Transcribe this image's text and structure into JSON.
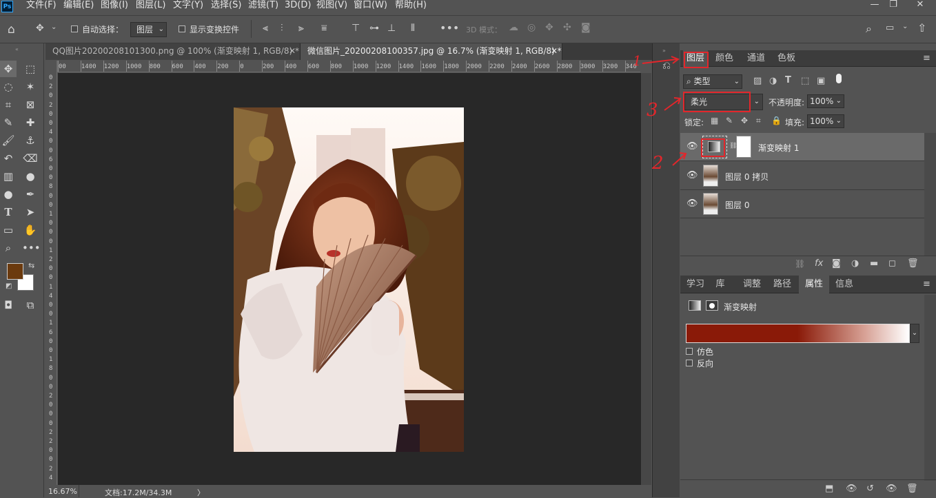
{
  "app": {
    "logo": "Ps"
  },
  "menu": [
    "文件(F)",
    "编辑(E)",
    "图像(I)",
    "图层(L)",
    "文字(Y)",
    "选择(S)",
    "滤镜(T)",
    "3D(D)",
    "视图(V)",
    "窗口(W)",
    "帮助(H)"
  ],
  "window_buttons": [
    "—",
    "❐",
    "✕"
  ],
  "options": {
    "auto_select_label": "自动选择：",
    "auto_select_value": "图层",
    "show_transform": "显示变换控件",
    "mode_3d": "3D 模式："
  },
  "tabs": [
    {
      "label": "QQ图片20200208101300.png @ 100% (渐变映射 1, RGB/8) *",
      "close": "✕"
    },
    {
      "label": "微信图片_20200208100357.jpg @ 16.7% (渐变映射 1, RGB/8) *",
      "close": "✕"
    }
  ],
  "ruler_h": [
    "00",
    "1400",
    "1200",
    "1000",
    "800",
    "600",
    "400",
    "200",
    "0",
    "200",
    "400",
    "600",
    "800",
    "1000",
    "1200",
    "1400",
    "1600",
    "1800",
    "2000",
    "2200",
    "2400",
    "2600",
    "2800",
    "3000",
    "3200",
    "340"
  ],
  "ruler_v": [
    "0",
    "2",
    "0",
    "2",
    "0",
    "0",
    "4",
    "0",
    "0",
    "6",
    "0",
    "0",
    "8",
    "0",
    "0",
    "1",
    "0",
    "0",
    "0",
    "1",
    "2",
    "0",
    "0",
    "1",
    "4",
    "0",
    "0",
    "1",
    "6",
    "0",
    "0",
    "1",
    "8",
    "0",
    "0",
    "2",
    "0",
    "0",
    "0",
    "2",
    "2",
    "0",
    "0",
    "2",
    "4"
  ],
  "status": {
    "zoom": "16.67%",
    "doc": "文档:17.2M/34.3M",
    "arrow": "〉"
  },
  "colors": {
    "foreground": "#6b3a0e",
    "background": "#ffffff",
    "accent": "#e3262b",
    "gradient_start": "#8a1a08",
    "gradient_end": "#ffffff"
  },
  "layers_panel": {
    "tabs": [
      "图层",
      "颜色",
      "通道",
      "色板"
    ],
    "filter_kind": "类型",
    "blend_mode": "柔光",
    "opacity_label": "不透明度:",
    "opacity": "100%",
    "lock_label": "锁定:",
    "fill_label": "填充:",
    "fill": "100%",
    "layers": [
      {
        "name": "渐变映射 1",
        "type": "adjustment"
      },
      {
        "name": "图层 0 拷贝",
        "type": "image"
      },
      {
        "name": "图层 0",
        "type": "image"
      }
    ]
  },
  "props_panel": {
    "tabs": [
      "学习",
      "库",
      "调整",
      "路径",
      "属性",
      "信息"
    ],
    "title": "渐变映射",
    "dither": "仿色",
    "reverse": "反向"
  },
  "annotations": [
    "1",
    "2",
    "3"
  ]
}
